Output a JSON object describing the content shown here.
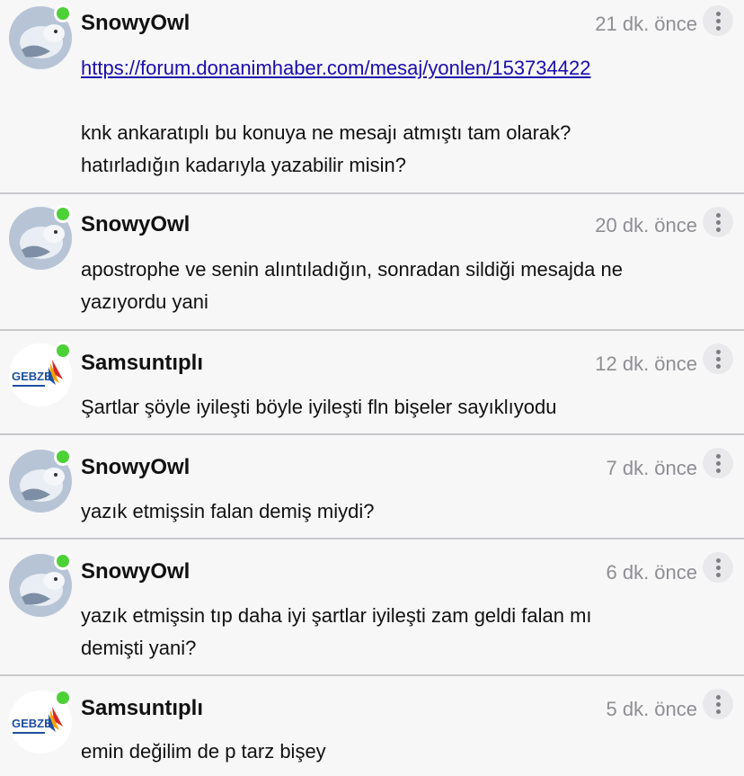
{
  "posts": [
    {
      "username": "SnowyOwl",
      "time": "21 dk. önce",
      "avatar": "snowy-owl-avatar",
      "link": "https://forum.donanimhaber.com/mesaj/yonlen/153734422",
      "lines": [
        "knk ankaratıplı bu konuya ne mesajı atmıştı tam olarak?",
        "hatırladığın kadarıyla yazabilir misin?"
      ]
    },
    {
      "username": "SnowyOwl",
      "time": "20 dk. önce",
      "avatar": "snowy-owl-avatar",
      "lines": [
        "apostrophe ve senin alıntıladığın, sonradan sildiği mesajda ne",
        "yazıyordu yani"
      ]
    },
    {
      "username": "Samsuntıplı",
      "time": "12 dk. önce",
      "avatar": "gebze-logo-avatar",
      "avatar_text": "GEBZE",
      "lines": [
        "Şartlar şöyle iyileşti böyle iyileşti fln bişeler sayıklıyodu"
      ]
    },
    {
      "username": "SnowyOwl",
      "time": "7 dk. önce",
      "avatar": "snowy-owl-avatar",
      "lines": [
        "yazık etmişsin falan demiş miydi?"
      ]
    },
    {
      "username": "SnowyOwl",
      "time": "6 dk. önce",
      "avatar": "snowy-owl-avatar",
      "lines": [
        "yazık etmişsin tıp daha iyi şartlar iyileşti zam geldi falan mı",
        "demişti yani?"
      ]
    },
    {
      "username": "Samsuntıplı",
      "time": "5 dk. önce",
      "avatar": "gebze-logo-avatar",
      "avatar_text": "GEBZE",
      "lines": [
        "emin değilim de p tarz bişey"
      ]
    }
  ],
  "colors": {
    "online": "#4cd137",
    "link": "#1a0dab",
    "time": "#8e8e93",
    "divider": "#c9c9cc",
    "background": "#f7f7f8"
  },
  "icons": {
    "online": "online-status-dot",
    "more": "more-options-icon"
  }
}
